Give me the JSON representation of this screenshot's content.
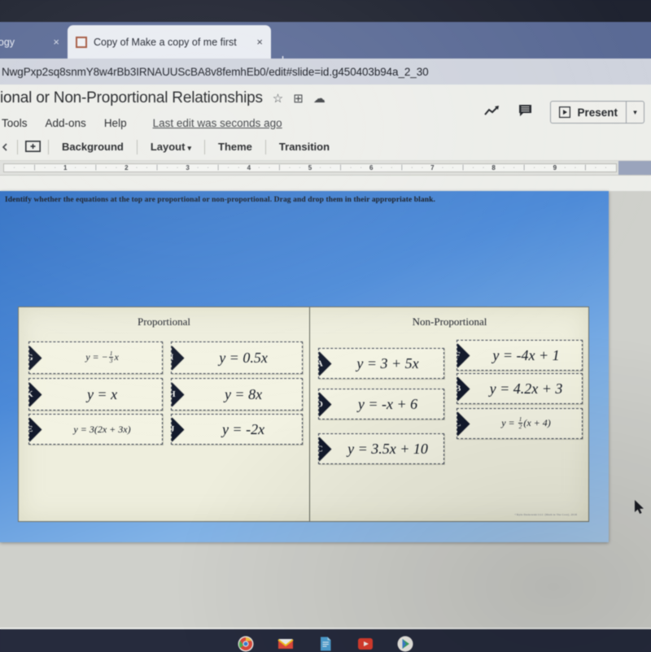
{
  "browser": {
    "tabs": [
      {
        "title": "choology",
        "active": false,
        "close_label": "×"
      },
      {
        "title": "Copy of Make a copy of me first",
        "active": true,
        "close_label": "×"
      }
    ],
    "new_tab_label": "+",
    "url": "NwgPxp2sq8snmY8w4rBb3IRNAUUScBA8v8femhEb0/edit#slide=id.g450403b94a_2_30"
  },
  "app": {
    "doc_title": "ional or Non-Proportional Relationships",
    "title_icons": [
      "star-icon",
      "move-to-folder-icon",
      "cloud-status-icon"
    ],
    "menus": [
      "Tools",
      "Add-ons",
      "Help"
    ],
    "last_edit": "Last edit was seconds ago",
    "present_label": "Present",
    "present_caret": "▾",
    "toolbar": {
      "new_slide_label": "+",
      "background": "Background",
      "layout": "Layout",
      "layout_caret": "▾",
      "theme": "Theme",
      "transition": "Transition"
    },
    "ruler_marks": [
      "1",
      "2",
      "3",
      "4",
      "5",
      "6",
      "7",
      "8",
      "9"
    ]
  },
  "slide": {
    "instructions": "Identify whether the equations at the top are proportional or non-proportional. Drag and drop them in their appropriate blank.",
    "background_color": "#4c8ad8",
    "worksheet": {
      "headings": {
        "left": "Proportional",
        "right": "Non-Proportional"
      },
      "credit": "©Kyle Derkowski LLC (Math in The Core), 2018",
      "proportional": [
        {
          "letter": "G",
          "equation": "y = -1/3 x",
          "size": "small"
        },
        {
          "letter": "I",
          "equation": "y = 0.5x",
          "size": "big"
        },
        {
          "letter": "K",
          "equation": "y = x",
          "size": "big"
        },
        {
          "letter": "H",
          "equation": "y = 8x",
          "size": "big"
        },
        {
          "letter": "E",
          "equation": "y = 3(2x + 3x)",
          "size": "small"
        },
        {
          "letter": "J",
          "equation": "y = -2x",
          "size": "big"
        }
      ],
      "non_proportional": [
        {
          "letter": "A",
          "equation": "y = 3 + 5x",
          "size": "big"
        },
        {
          "letter": "F",
          "equation": "y = -4x + 1",
          "size": "big"
        },
        {
          "letter": "B",
          "equation": "y = 4.2x + 3",
          "size": "big"
        },
        {
          "letter": "D",
          "equation": "y = -x + 6",
          "size": "big"
        },
        {
          "letter": "L",
          "equation": "y = 1/2(x + 4)",
          "size": "small"
        },
        {
          "letter": "C",
          "equation": "y = 3.5x + 10",
          "size": "big"
        }
      ]
    }
  },
  "shelf": {
    "icons": [
      "chrome-icon",
      "gmail-icon",
      "docs-icon",
      "youtube-icon",
      "play-store-icon"
    ]
  }
}
